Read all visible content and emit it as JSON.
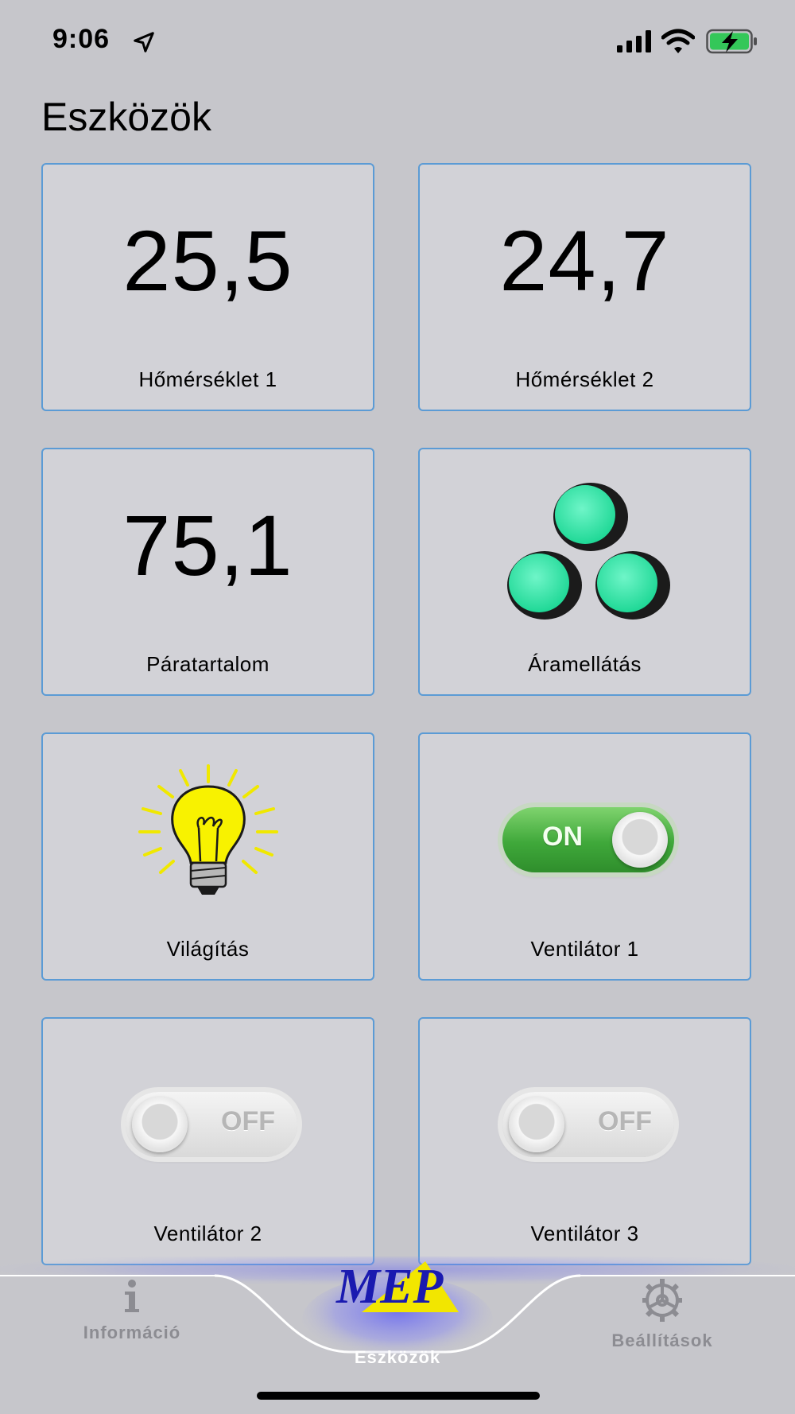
{
  "status_bar": {
    "time": "9:06"
  },
  "page": {
    "title": "Eszközök"
  },
  "tiles": [
    {
      "value": "25,5",
      "label": "Hőmérséklet 1"
    },
    {
      "value": "24,7",
      "label": "Hőmérséklet 2"
    },
    {
      "value": "75,1",
      "label": "Páratartalom"
    },
    {
      "label": "Áramellátás"
    },
    {
      "label": "Világítás"
    },
    {
      "label": "Ventilátor 1",
      "state": "ON"
    },
    {
      "label": "Ventilátor 2",
      "state": "OFF"
    },
    {
      "label": "Ventilátor 3",
      "state": "OFF"
    }
  ],
  "tab_bar": {
    "logo_text": "MEP",
    "items": [
      {
        "label": "Információ"
      },
      {
        "label": "Eszközök"
      },
      {
        "label": "Beállítások"
      }
    ]
  },
  "colors": {
    "background": "#c6c6cb",
    "tile_border": "#5b9bd5",
    "power_led": "#2fe6a8",
    "bulb": "#f5f000",
    "toggle_on": "#3fa83a",
    "logo_blue": "#1a1ab0",
    "logo_yellow": "#f2e600"
  },
  "icons": [
    "location-arrow-icon",
    "cellular-signal-icon",
    "wifi-icon",
    "battery-charging-icon",
    "power-indicator-lights-icon",
    "light-bulb-icon",
    "info-icon",
    "gear-icon"
  ]
}
